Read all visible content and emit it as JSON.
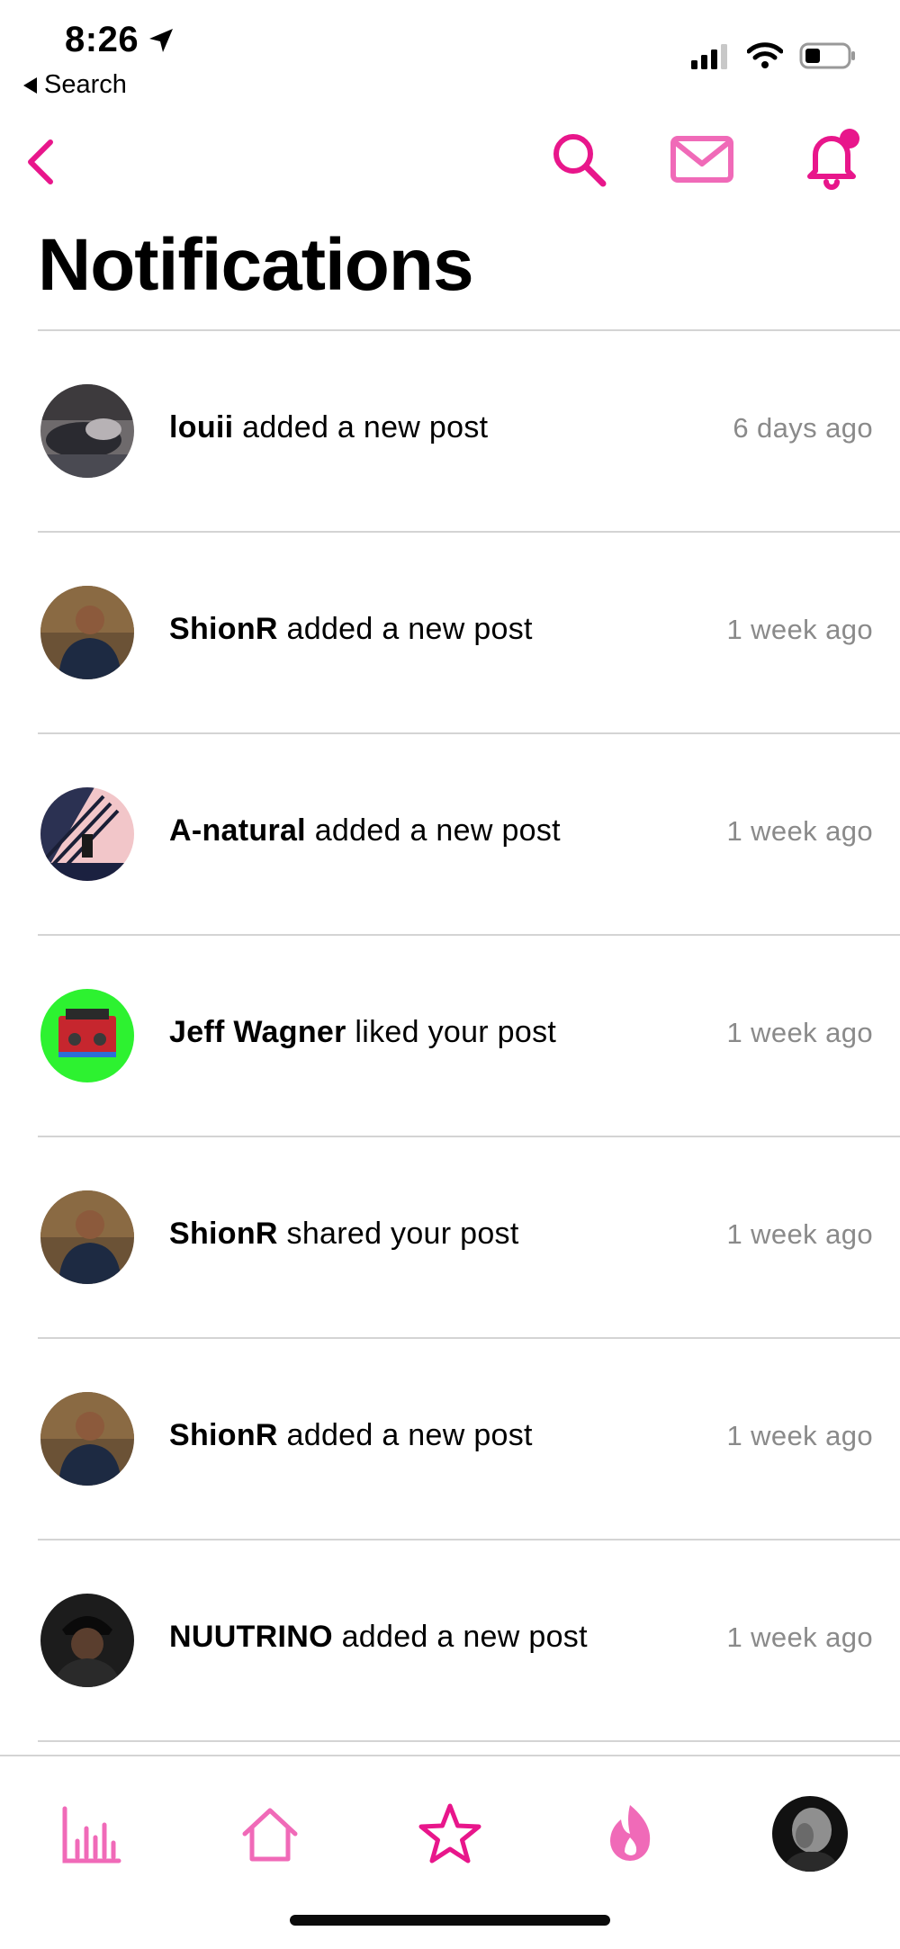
{
  "status_bar": {
    "time": "8:26",
    "back_label": "Search"
  },
  "page": {
    "title": "Notifications"
  },
  "notifications": [
    {
      "user": "louii",
      "action": "added a new post",
      "time": "6 days ago"
    },
    {
      "user": "ShionR",
      "action": "added a new post",
      "time": "1 week ago"
    },
    {
      "user": "A-natural",
      "action": "added a new post",
      "time": "1 week ago"
    },
    {
      "user": "Jeff Wagner",
      "action": "liked your post",
      "time": "1 week ago"
    },
    {
      "user": "ShionR",
      "action": "shared your post",
      "time": "1 week ago"
    },
    {
      "user": "ShionR",
      "action": "added a new post",
      "time": "1 week ago"
    },
    {
      "user": "NUUTRINO",
      "action": "added a new post",
      "time": "1 week ago"
    }
  ],
  "icons": {
    "nav": [
      "back-chevron-icon",
      "search-icon",
      "mail-icon",
      "bell-icon"
    ],
    "tabs": [
      "stats-icon",
      "home-icon",
      "star-icon",
      "flame-icon",
      "profile-avatar"
    ]
  },
  "colors": {
    "accent": "#e8168b",
    "accent_light": "#f06ab8",
    "text": "#000000",
    "muted": "#8a8a8a",
    "divider": "#d4d4d4"
  }
}
